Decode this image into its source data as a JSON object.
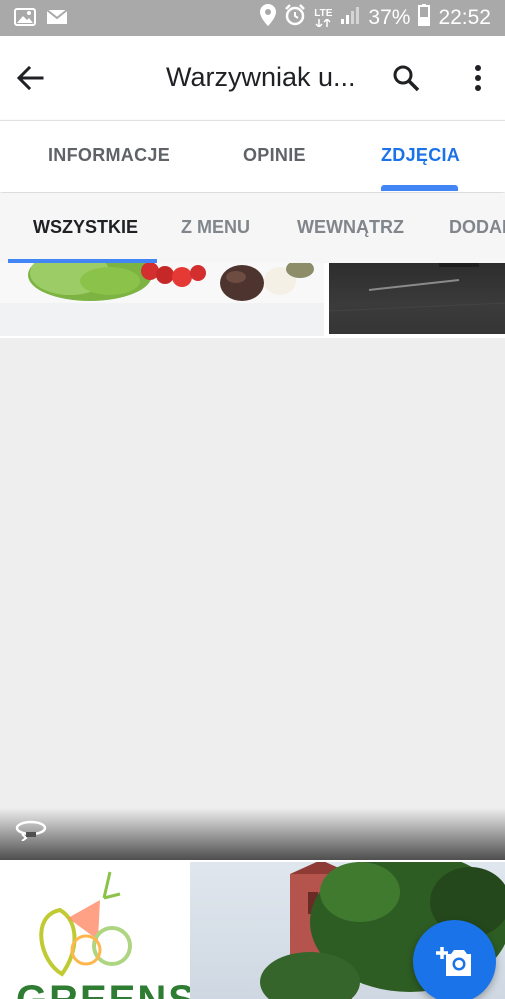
{
  "status_bar": {
    "icons_left": [
      "image-icon",
      "gmail-icon"
    ],
    "icons_right": [
      "location-icon",
      "alarm-icon",
      "lte-icon",
      "signal-icon"
    ],
    "lte_label": "LTE",
    "battery": "37%",
    "time": "22:52"
  },
  "app_bar": {
    "title": "Warzywniak u...",
    "back_icon": "arrow-left-icon",
    "search_icon": "search-icon",
    "more_icon": "more-vert-icon"
  },
  "main_tabs": [
    {
      "label": "INFORMACJE",
      "active": false
    },
    {
      "label": "OPINIE",
      "active": false
    },
    {
      "label": "ZDJĘCIA",
      "active": true
    }
  ],
  "sub_tabs": [
    {
      "label": "WSZYSTKIE",
      "active": true
    },
    {
      "label": "Z MENU",
      "active": false
    },
    {
      "label": "WEWNĄTRZ",
      "active": false
    },
    {
      "label": "DODANE",
      "active": false
    }
  ],
  "photos": {
    "greens_logo_text": "GREENS",
    "panorama_icon": "360-rotate-icon"
  },
  "fab": {
    "icon": "add-photo-icon"
  },
  "colors": {
    "accent": "#1a73e8",
    "indicator": "#4285f4",
    "status_bar": "#a9a9a9"
  }
}
